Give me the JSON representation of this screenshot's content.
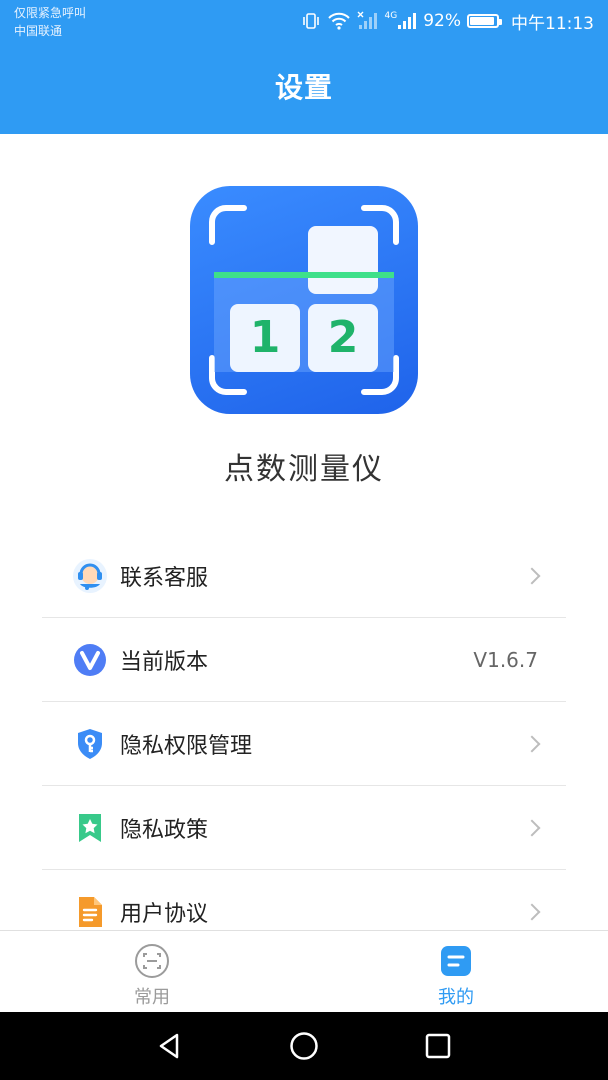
{
  "status_bar": {
    "carrier_line1": "仅限紧急呼叫",
    "carrier_line2": "中国联通",
    "network": "4G",
    "battery": "92%",
    "battery_level": 0.92,
    "time": "中午11:13"
  },
  "header": {
    "title": "设置"
  },
  "app": {
    "name": "点数测量仪",
    "logo_digits": [
      "1",
      "2"
    ],
    "logo_colors": {
      "background": "#2f74f0",
      "digits": "#1fb36a",
      "scan_line": "#3ee08a"
    }
  },
  "menu": {
    "items": [
      {
        "label": "联系客服",
        "icon": "headset-agent-icon",
        "right": ""
      },
      {
        "label": "当前版本",
        "icon": "version-v-icon",
        "right": "V1.6.7"
      },
      {
        "label": "隐私权限管理",
        "icon": "shield-key-icon",
        "right": ""
      },
      {
        "label": "隐私政策",
        "icon": "bookmark-star-icon",
        "right": ""
      },
      {
        "label": "用户协议",
        "icon": "document-icon",
        "right": ""
      }
    ]
  },
  "tabs": [
    {
      "label": "常用",
      "icon": "scan-face-icon",
      "active": false
    },
    {
      "label": "我的",
      "icon": "profile-card-icon",
      "active": true
    }
  ],
  "colors": {
    "primary": "#2f9bf3",
    "tab_inactive": "#9b9b9b",
    "tab_active": "#2f9bf3"
  },
  "navigation_bar": {
    "buttons": [
      "back-triangle-icon",
      "home-circle-icon",
      "recents-square-icon"
    ]
  }
}
